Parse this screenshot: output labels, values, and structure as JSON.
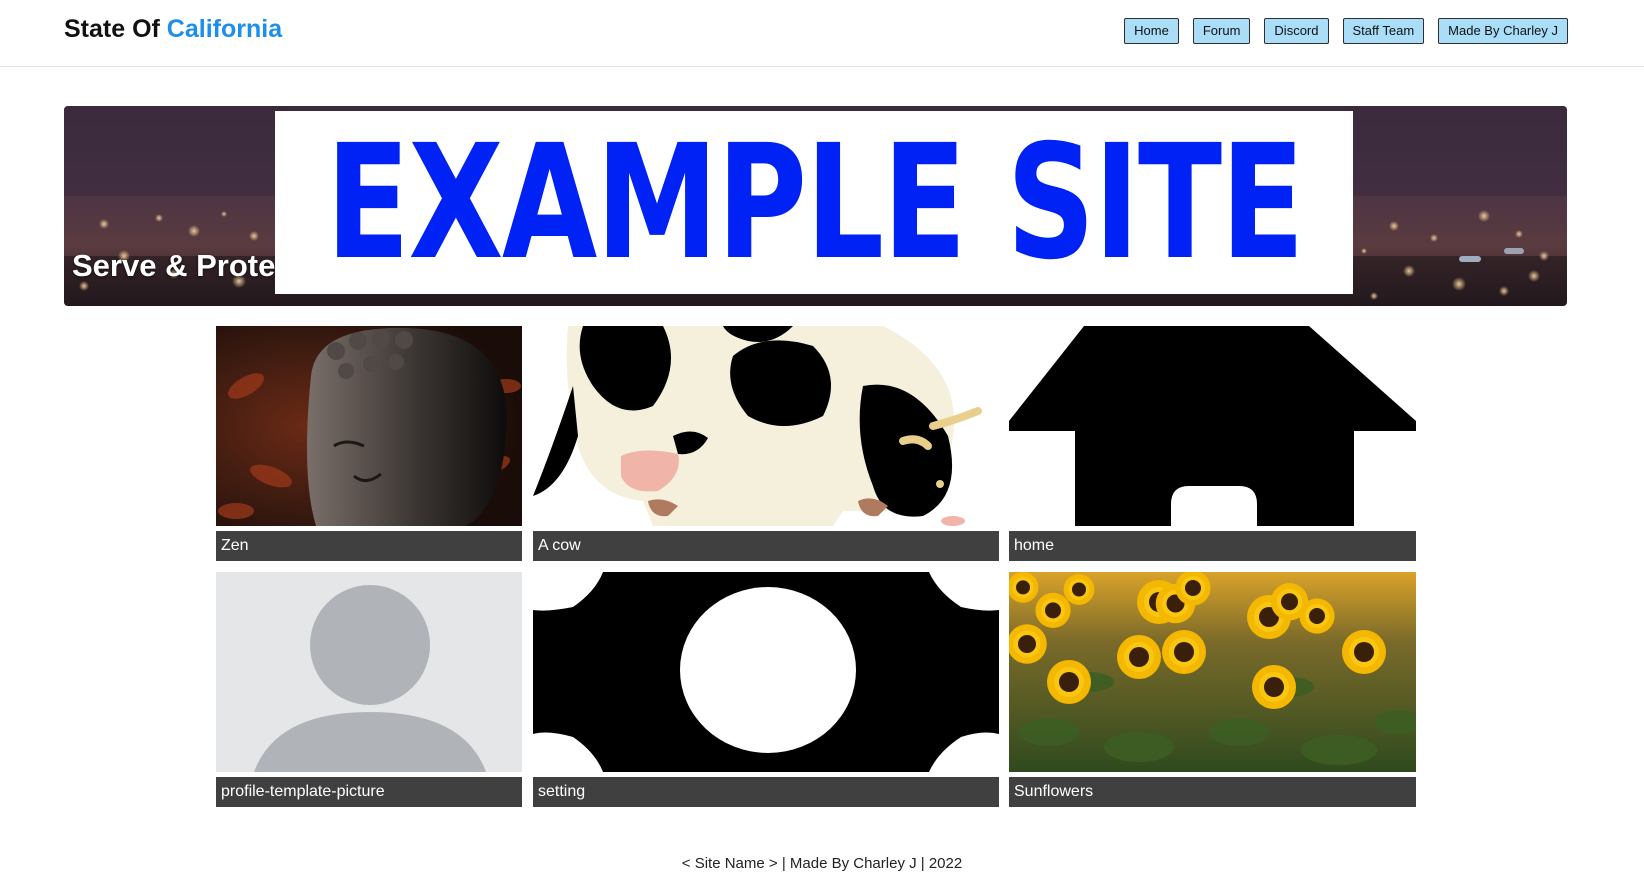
{
  "header": {
    "brand_prefix": "State Of ",
    "brand_accent": "California",
    "nav": [
      "Home",
      "Forum",
      "Discord",
      "Staff Team",
      "Made By Charley J"
    ]
  },
  "banner": {
    "tagline": "Serve & Protect the Citizens Of U.S.",
    "overlay_text": "EXAMPLE SITE"
  },
  "gallery": [
    {
      "caption": "Zen",
      "image": "buddha-statue-photo"
    },
    {
      "caption": "A cow",
      "image": "cow-illustration"
    },
    {
      "caption": "home",
      "image": "home-icon"
    },
    {
      "caption": "profile-template-picture",
      "image": "profile-placeholder"
    },
    {
      "caption": "setting",
      "image": "gear-icon"
    },
    {
      "caption": "Sunflowers",
      "image": "sunflowers-photo"
    }
  ],
  "footer": "< Site Name > | Made By Charley J | 2022",
  "colors": {
    "accent": "#1d8fe8",
    "nav_button": "#a9ddf8",
    "caption_bar": "#404040",
    "example_text": "#0022f5"
  }
}
